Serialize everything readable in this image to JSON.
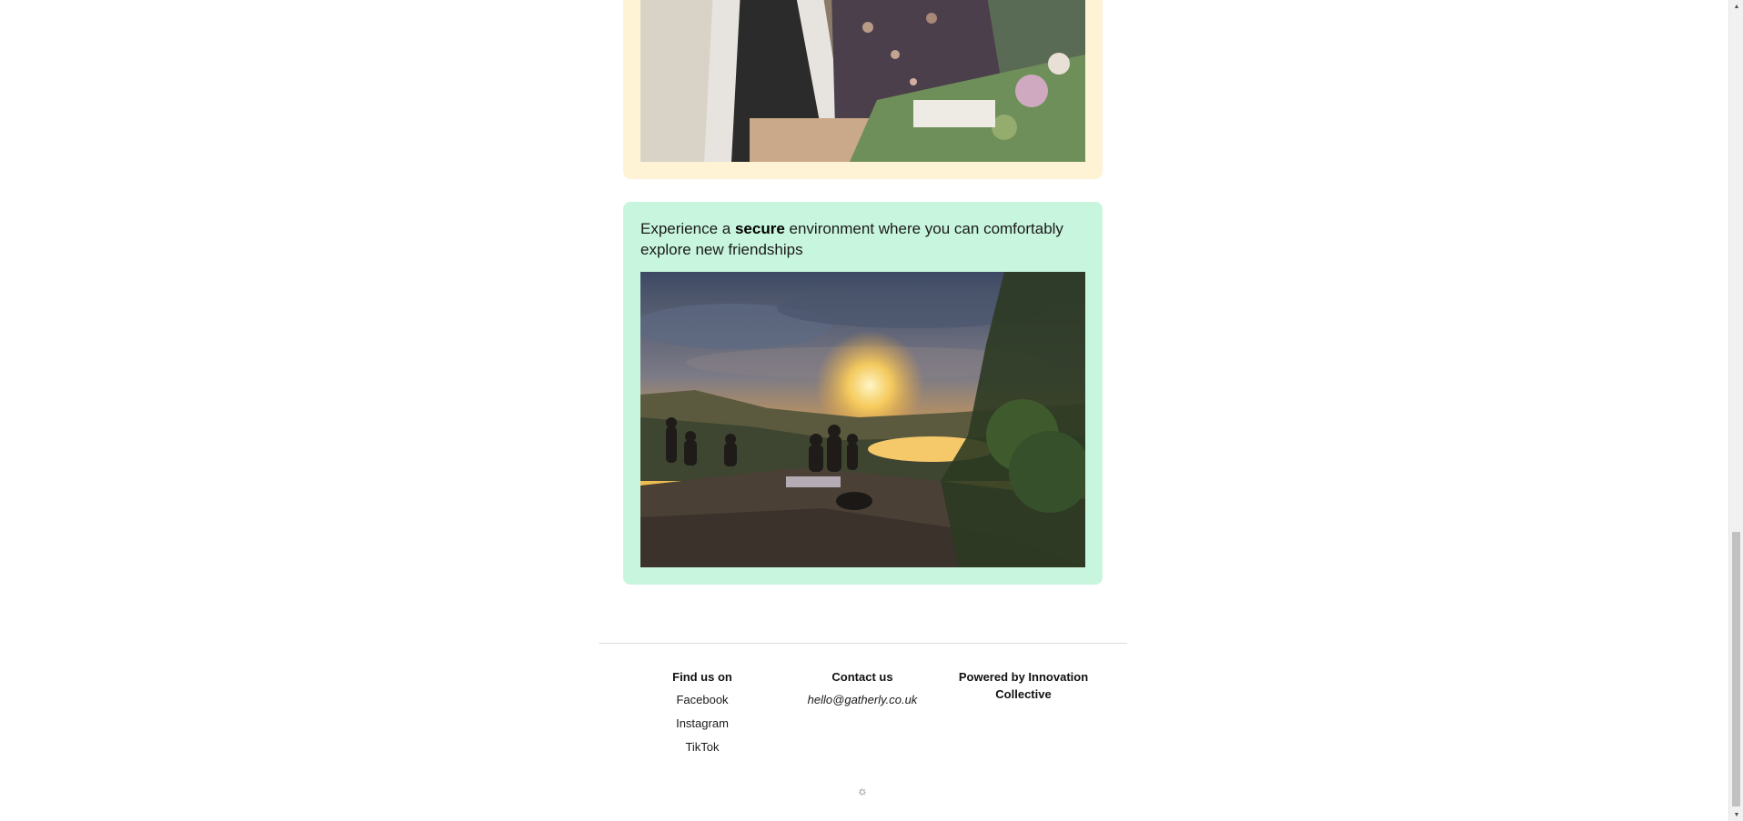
{
  "cards": {
    "workshop": {
      "photo_alt": "People gathered around a table doing a craft workshop"
    },
    "secure": {
      "caption_before": "Experience a ",
      "caption_bold": "secure",
      "caption_after": " environment where you can comfortably explore new friendships",
      "photo_alt": "Group of friends sitting on a hilltop watching the sunset over a lake"
    }
  },
  "footer": {
    "find_us": {
      "heading": "Find us on",
      "links": [
        "Facebook",
        "Instagram",
        "TikTok"
      ]
    },
    "contact": {
      "heading": "Contact us",
      "email": "hello@gatherly.co.uk"
    },
    "powered": {
      "heading": "Powered by Innovation Collective"
    },
    "theme_toggle_icon": "sun-icon"
  },
  "colors": {
    "card_yellow": "#fff3d6",
    "card_green": "#c8f5dd",
    "divider": "#dddddd"
  }
}
